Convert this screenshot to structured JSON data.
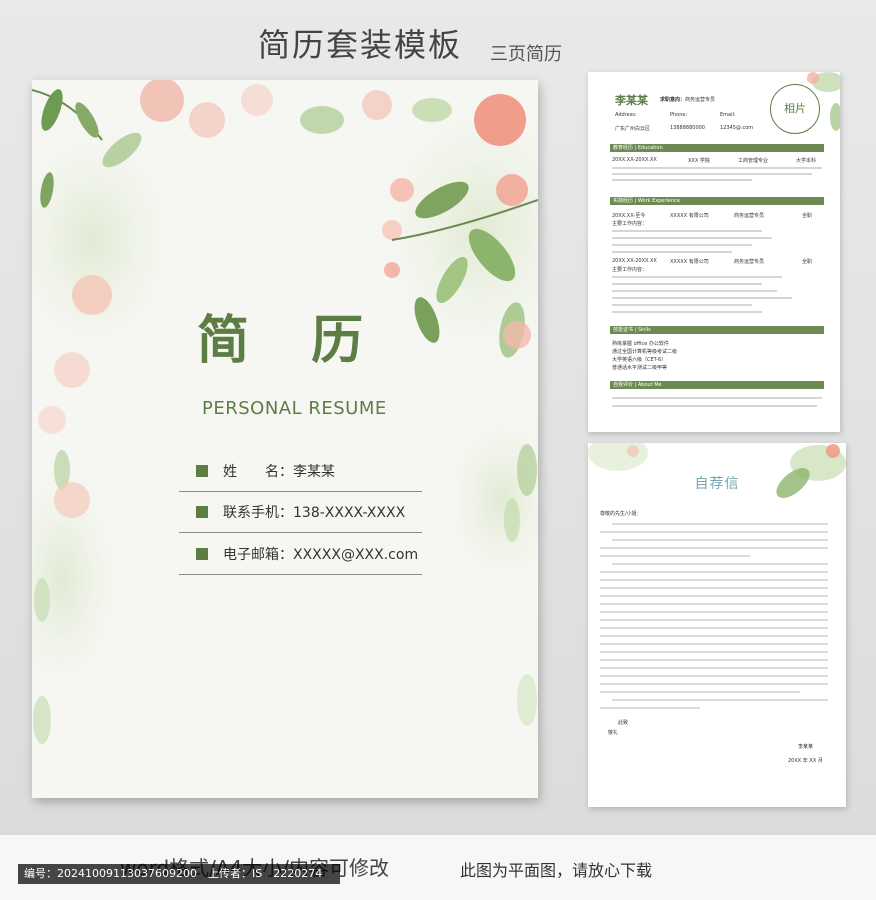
{
  "header": {
    "title": "简历套装模板",
    "subtitle": "三页简历"
  },
  "cover": {
    "title": "简 历",
    "subtitle_en": "PERSONAL RESUME",
    "rows": [
      {
        "label": "姓　　名：",
        "value": "李某某"
      },
      {
        "label": "联系手机：",
        "value": "138-XXXX-XXXX"
      },
      {
        "label": "电子邮箱：",
        "value": "XXXXX@XXX.com"
      }
    ]
  },
  "resume": {
    "name": "李某某",
    "job_label": "求职意向：",
    "job_value": "商务运营专员",
    "photo": "相片",
    "address_label": "Address:",
    "address_value": "广东广州白云区",
    "phone_label": "Phone:",
    "phone_value": "13888880000",
    "email_label": "Email:",
    "email_value": "12345@.com",
    "sections": {
      "education": "教育经历 | Education",
      "work": "实践经历 | Work Experience",
      "skills": "技能证书 | Skills",
      "about": "自我评价 | About Me"
    },
    "edu_row": {
      "date": "20XX.XX-20XX.XX",
      "school": "XXX 学院",
      "major": "工商管理专业",
      "degree": "大学本科"
    },
    "work1": {
      "date": "20XX.XX-至今",
      "company": "XXXXX 有限公司",
      "position": "商务运营专员",
      "type": "全职",
      "content": "主要工作内容："
    },
    "work2": {
      "date": "20XX.XX-20XX.XX",
      "company": "XXXXX 有限公司",
      "position": "商务运营专员",
      "type": "全职",
      "content": "主要工作内容："
    },
    "skills": [
      "熟练掌握 office 办公软件",
      "通过全国计算机等级考试二级",
      "大学英语六级（CET-6）",
      "普通话水平测试二级甲等"
    ]
  },
  "letter": {
    "title": "自荐信",
    "greeting": "尊敬的先生/小姐：",
    "closing": "此致",
    "salute": "敬礼",
    "signature": "李某某",
    "date": "20XX 年 XX 月"
  },
  "footer": {
    "word": "word格式/A4大小/内容可修改",
    "note": "此图为平面图，请放心下载",
    "stamp": "编号：20241009113037609200　上传者：IS　2220274"
  },
  "colors": {
    "accent": "#5d7d45",
    "bar": "#6c8a52",
    "letter_title": "#7aa4b3"
  }
}
